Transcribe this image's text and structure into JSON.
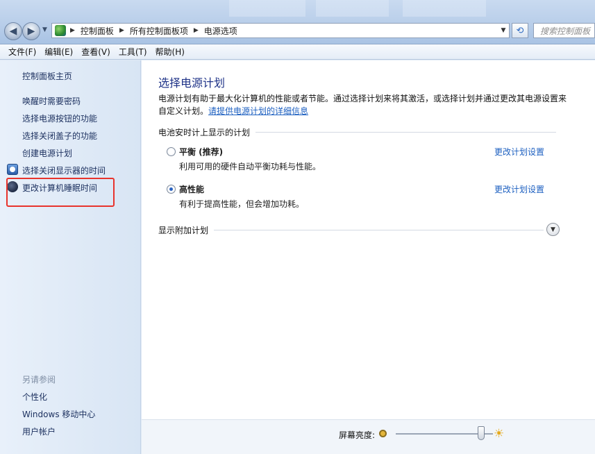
{
  "window": {
    "breadcrumb": [
      "控制面板",
      "所有控制面板项",
      "电源选项"
    ],
    "search_placeholder": "搜索控制面板"
  },
  "menu": [
    "文件(F)",
    "编辑(E)",
    "查看(V)",
    "工具(T)",
    "帮助(H)"
  ],
  "sidebar": {
    "home": "控制面板主页",
    "links": [
      "唤醒时需要密码",
      "选择电源按钮的功能",
      "选择关闭盖子的功能",
      "创建电源计划",
      "选择关闭显示器的时间",
      "更改计算机睡眠时间"
    ],
    "see_also_title": "另请参阅",
    "see_also": [
      "个性化",
      "Windows 移动中心",
      "用户帐户"
    ]
  },
  "main": {
    "title": "选择电源计划",
    "desc": "电源计划有助于最大化计算机的性能或者节能。通过选择计划来将其激活，或选择计划并通过更改其电源设置来自定义计划。",
    "desc_link": "请提供电源计划的详细信息",
    "group_label": "电池安时计上显示的计划",
    "plans": [
      {
        "name": "平衡 (推荐)",
        "desc": "利用可用的硬件自动平衡功耗与性能。",
        "link": "更改计划设置",
        "selected": false
      },
      {
        "name": "高性能",
        "desc": "有利于提高性能，但会增加功耗。",
        "link": "更改计划设置",
        "selected": true
      }
    ],
    "more_plans": "显示附加计划"
  },
  "bottom": {
    "brightness_label": "屏幕亮度:",
    "brightness_level": 0.88
  }
}
